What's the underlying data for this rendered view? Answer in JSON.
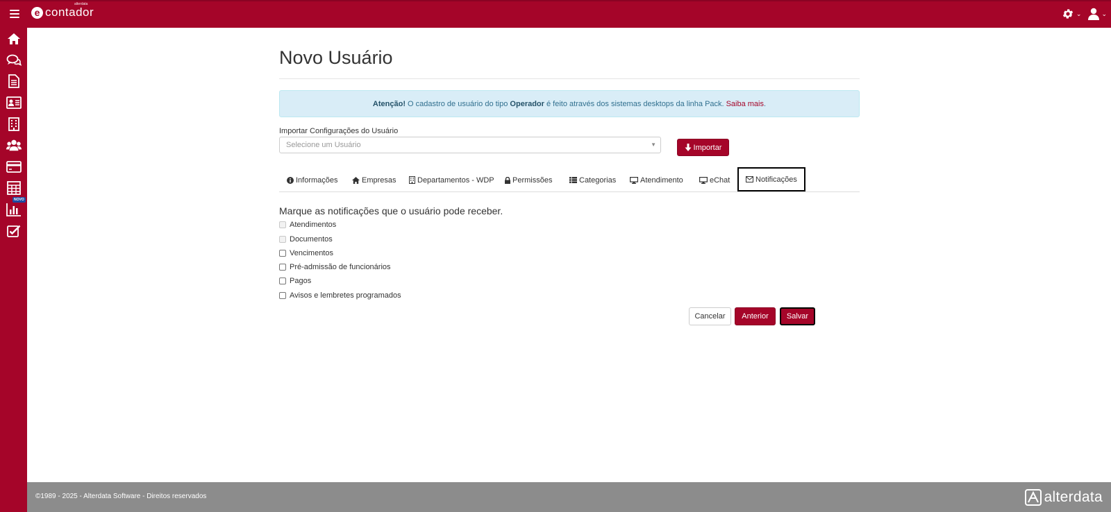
{
  "header": {
    "logo_text": "contador",
    "logo_small": "alterdata",
    "colors": {
      "brand": "#a50529",
      "footer": "#8c8c8c"
    }
  },
  "sidebar": {
    "items": [
      {
        "icon": "home-icon"
      },
      {
        "icon": "chat-icon"
      },
      {
        "icon": "document-icon"
      },
      {
        "icon": "id-card-icon"
      },
      {
        "icon": "building-icon"
      },
      {
        "icon": "users-icon"
      },
      {
        "icon": "credit-card-icon"
      },
      {
        "icon": "calculator-icon"
      },
      {
        "icon": "bar-chart-icon",
        "badge": "NOVO"
      },
      {
        "icon": "checklist-icon"
      }
    ]
  },
  "page": {
    "title": "Novo Usuário"
  },
  "alert": {
    "bold_prefix": "Atenção!",
    "text_1": "O cadastro de usuário do tipo",
    "bold_mid": "Operador",
    "text_2": "é feito através dos sistemas desktops da linha Pack.",
    "link": "Saiba mais",
    "suffix": "."
  },
  "import": {
    "label": "Importar Configurações do Usuário",
    "placeholder": "Selecione um Usuário",
    "button": "Importar"
  },
  "tabs": [
    {
      "label": "Informações",
      "icon": "info-icon"
    },
    {
      "label": "Empresas",
      "icon": "home-icon"
    },
    {
      "label": "Departamentos - WDP",
      "icon": "building-icon"
    },
    {
      "label": "Permissões",
      "icon": "lock-icon"
    },
    {
      "label": "Categorias",
      "icon": "list-icon"
    },
    {
      "label": "Atendimento",
      "icon": "monitor-icon"
    },
    {
      "label": "eChat",
      "icon": "monitor-icon"
    },
    {
      "label": "Notificações",
      "icon": "envelope-icon",
      "active": true
    }
  ],
  "notifications": {
    "heading": "Marque as notificações que o usuário pode receber.",
    "options": [
      {
        "label": "Atendimentos",
        "checked": false,
        "disabled": true
      },
      {
        "label": "Documentos",
        "checked": false,
        "disabled": true
      },
      {
        "label": "Vencimentos",
        "checked": false,
        "disabled": false
      },
      {
        "label": "Pré-admissão de funcionários",
        "checked": false,
        "disabled": false
      },
      {
        "label": "Pagos",
        "checked": false,
        "disabled": false
      },
      {
        "label": "Avisos e lembretes programados",
        "checked": false,
        "disabled": false
      }
    ]
  },
  "actions": {
    "cancel": "Cancelar",
    "previous": "Anterior",
    "save": "Salvar"
  },
  "footer": {
    "copyright": "©1989 - 2025 - Alterdata Software - Direitos reservados",
    "logo_text": "alterdata"
  }
}
